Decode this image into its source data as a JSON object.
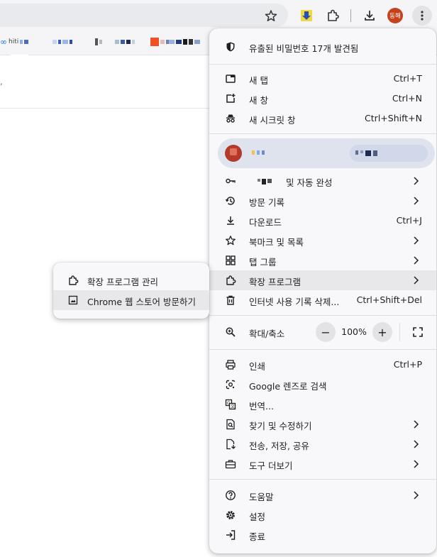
{
  "toolbar": {
    "profile_initials": "동해",
    "icons": [
      "star-icon",
      "extension-download-icon",
      "puzzle-icon",
      "download-icon",
      "more-vert-icon"
    ]
  },
  "bookmarks": {
    "first_label": "hiti"
  },
  "menu": {
    "password_alert": "유출된 비밀번호 17개 발견됨",
    "new_tab": {
      "label": "새 탭",
      "shortcut": "Ctrl+T"
    },
    "new_window": {
      "label": "새 창",
      "shortcut": "Ctrl+N"
    },
    "incognito": {
      "label": "새 시크릿 창",
      "shortcut": "Ctrl+Shift+N"
    },
    "passwords": {
      "label": "및 자동 완성"
    },
    "history": {
      "label": "방문 기록"
    },
    "downloads": {
      "label": "다운로드",
      "shortcut": "Ctrl+J"
    },
    "bookmarks": {
      "label": "북마크 및 목록"
    },
    "tab_groups": {
      "label": "탭 그룹"
    },
    "extensions": {
      "label": "확장 프로그램"
    },
    "clear_data": {
      "label": "인터넷 사용 기록 삭제...",
      "shortcut": "Ctrl+Shift+Del"
    },
    "zoom": {
      "label": "확대/축소",
      "minus": "−",
      "value": "100%",
      "plus": "+"
    },
    "print": {
      "label": "인쇄",
      "shortcut": "Ctrl+P"
    },
    "lens": {
      "label": "Google 렌즈로 검색"
    },
    "translate": {
      "label": "번역..."
    },
    "find_edit": {
      "label": "찾기 및 수정하기"
    },
    "cast_save": {
      "label": "전송, 저장, 공유"
    },
    "more_tools": {
      "label": "도구 더보기"
    },
    "help": {
      "label": "도움말"
    },
    "settings": {
      "label": "설정"
    },
    "exit": {
      "label": "종료"
    }
  },
  "submenu": {
    "manage": "확장 프로그램 관리",
    "webstore": "Chrome 웹 스토어 방문하기"
  },
  "colors": {
    "accent_avatar": "#c5421c",
    "menu_bg": "#f8f8fa",
    "highlight": "#e8e8eb",
    "profile_bg": "#dfe3ee"
  }
}
